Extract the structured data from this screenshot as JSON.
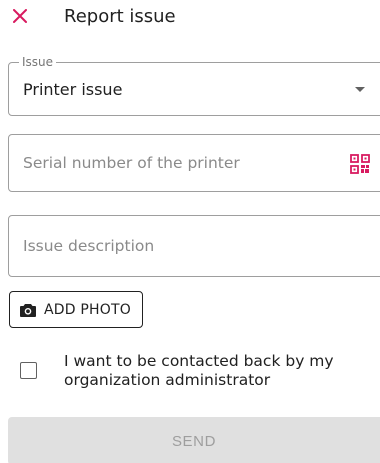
{
  "header": {
    "title": "Report issue",
    "close_icon": "close-icon"
  },
  "form": {
    "issue_select": {
      "legend": "Issue",
      "value": "Printer issue"
    },
    "serial_input": {
      "placeholder": "Serial number of the printer",
      "value": "",
      "icon": "qr-code-icon"
    },
    "description_input": {
      "placeholder": "Issue description",
      "value": ""
    },
    "add_photo": {
      "label": "ADD PHOTO",
      "icon": "camera-icon"
    },
    "contact_checkbox": {
      "checked": false,
      "label": "I want to be contacted back by my organization administrator"
    },
    "send_button": {
      "label": "SEND",
      "disabled": true
    }
  },
  "colors": {
    "accent": "#d81b60",
    "text_primary": "#212121",
    "border": "#9e9e9e",
    "disabled_bg": "#e0e0e0",
    "disabled_text": "#9e9e9e"
  }
}
